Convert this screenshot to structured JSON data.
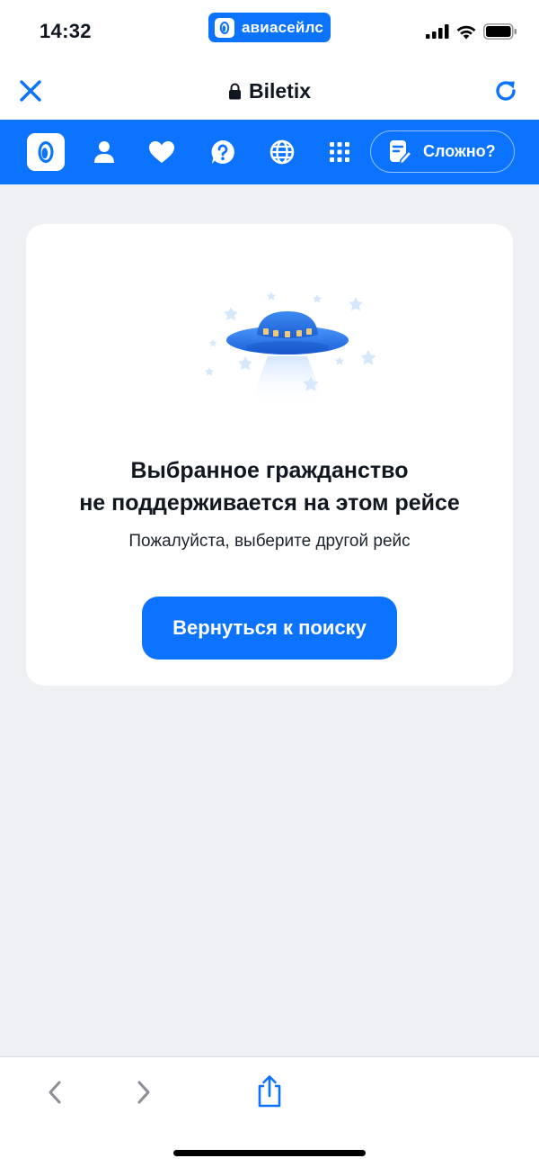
{
  "status_bar": {
    "time": "14:32",
    "app_name": "авиасейлс",
    "icons": [
      "signal-icon",
      "wifi-icon",
      "battery-icon"
    ]
  },
  "browser": {
    "site_name": "Biletix",
    "close_icon": "close-icon",
    "reload_icon": "reload-icon",
    "lock_icon": "lock-icon"
  },
  "nav": {
    "items": [
      "logo-icon",
      "profile-icon",
      "heart-icon",
      "help-icon",
      "globe-icon",
      "apps-grid-icon"
    ],
    "help_button_label": "Сложно?"
  },
  "card": {
    "title_line1": "Выбранное гражданство",
    "title_line2": "не поддерживается на этом рейсе",
    "subtitle": "Пожалуйста, выберите другой рейс",
    "button_label": "Вернуться к поиску"
  },
  "toolbar": {
    "items": [
      "back-icon",
      "forward-icon",
      "share-icon"
    ]
  },
  "colors": {
    "accent": "#0c73fe",
    "background": "#eff0f4",
    "card": "#ffffff",
    "text": "#101720"
  }
}
